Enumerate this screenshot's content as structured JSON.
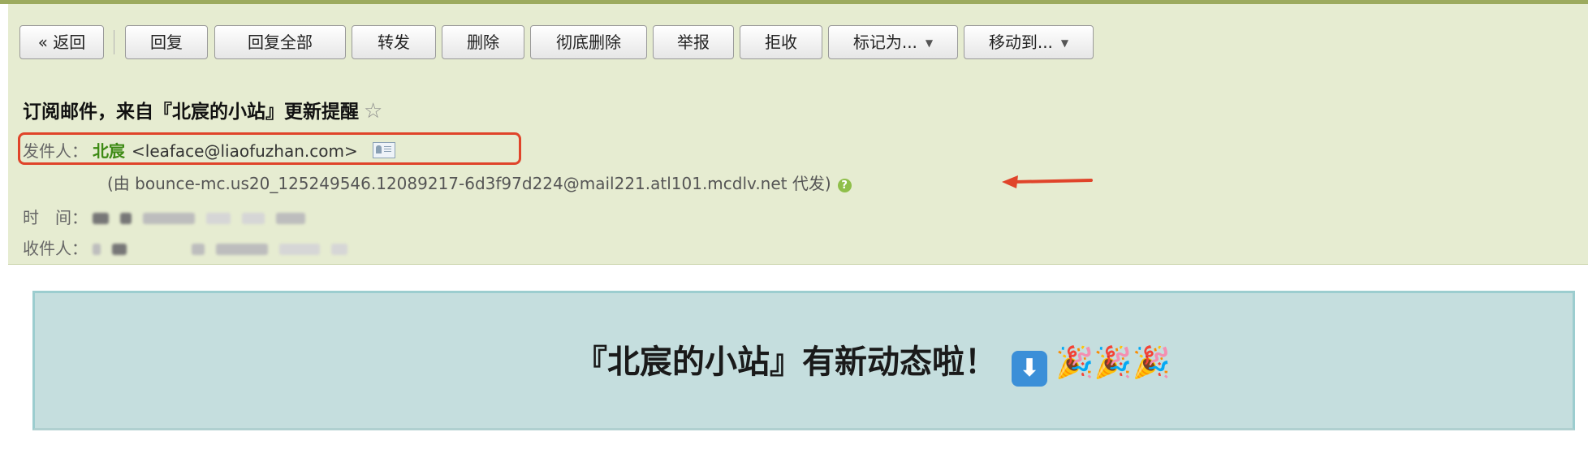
{
  "toolbar": {
    "back_label": "« 返回",
    "reply_label": "回复",
    "reply_all_label": "回复全部",
    "forward_label": "转发",
    "delete_label": "删除",
    "delete_permanently_label": "彻底删除",
    "report_label": "举报",
    "reject_label": "拒收",
    "mark_as_label": "标记为...",
    "move_to_label": "移动到..."
  },
  "email": {
    "subject": "订阅邮件，来自『北宸的小站』更新提醒",
    "star_icon": "☆",
    "sender_label": "发件人：",
    "sender_name": "北宸",
    "sender_address": "<leaface@liaofuzhan.com>",
    "via_text": "(由 bounce-mc.us20_125249546.12089217-6d3f97d224@mail221.atl101.mcdlv.net 代发)",
    "help_icon": "?",
    "time_label": "时　间：",
    "recipient_label": "收件人："
  },
  "banner": {
    "text": "『北宸的小站』有新动态啦！",
    "down_icon": "⬇",
    "party_icons": "🎉🎉🎉"
  },
  "colors": {
    "panel_bg": "#e6ecd1",
    "sender_name": "#3d8a14",
    "highlight_box": "#e0442a",
    "banner_bg": "#c5dede"
  }
}
